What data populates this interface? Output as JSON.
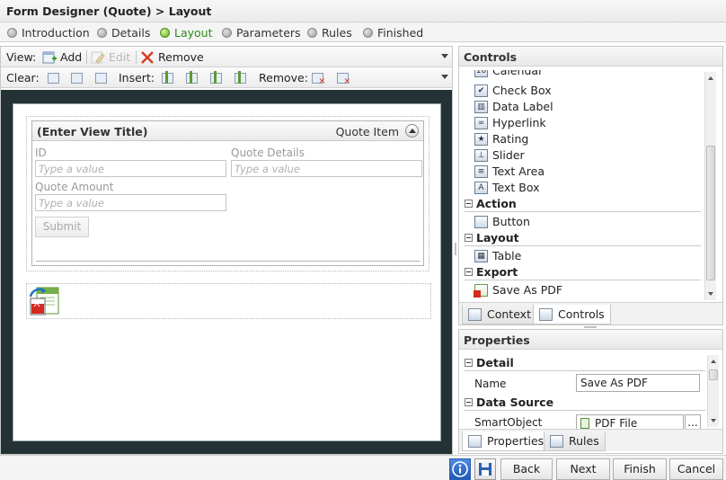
{
  "title": "Form Designer (Quote) > Layout",
  "steps": [
    {
      "label": "Introduction"
    },
    {
      "label": "Details"
    },
    {
      "label": "Layout"
    },
    {
      "label": "Parameters"
    },
    {
      "label": "Rules"
    },
    {
      "label": "Finished"
    }
  ],
  "active_step": "Layout",
  "view_toolbar": {
    "view_label": "View:",
    "add_label": "Add",
    "edit_label": "Edit",
    "remove_label": "Remove"
  },
  "clear_toolbar": {
    "clear_label": "Clear:",
    "insert_label": "Insert:",
    "remove_label": "Remove:"
  },
  "view": {
    "title": "(Enter View Title)",
    "name": "Quote Item",
    "fields": [
      {
        "label": "ID",
        "placeholder": "Type a value"
      },
      {
        "label": "Quote Details",
        "placeholder": "Type a value"
      },
      {
        "label": "Quote Amount",
        "placeholder": "Type a value"
      }
    ],
    "submit_label": "Submit"
  },
  "controls_panel": {
    "title": "Controls",
    "partial_item": "Calendar",
    "items": [
      "Check Box",
      "Data Label",
      "Hyperlink",
      "Rating",
      "Slider",
      "Text Area",
      "Text Box"
    ],
    "categories": [
      {
        "name": "Action",
        "items": [
          "Button"
        ]
      },
      {
        "name": "Layout",
        "items": [
          "Table"
        ]
      },
      {
        "name": "Export",
        "items": [
          "Save As PDF"
        ]
      }
    ],
    "tabs": [
      "Context",
      "Controls"
    ]
  },
  "properties_panel": {
    "title": "Properties",
    "detail_section": "Detail",
    "name_label": "Name",
    "name_value": "Save As PDF",
    "data_source_section": "Data Source",
    "smartobject_label": "SmartObject",
    "smartobject_value": "PDF File",
    "browse_label": "...",
    "tabs": [
      "Properties",
      "Rules"
    ]
  },
  "footer": {
    "back": "Back",
    "next": "Next",
    "finish": "Finish",
    "cancel": "Cancel"
  },
  "colors": {
    "active_step": "#2e8a1c",
    "canvas_bg": "#243235",
    "info_button": "#2a62b5"
  }
}
